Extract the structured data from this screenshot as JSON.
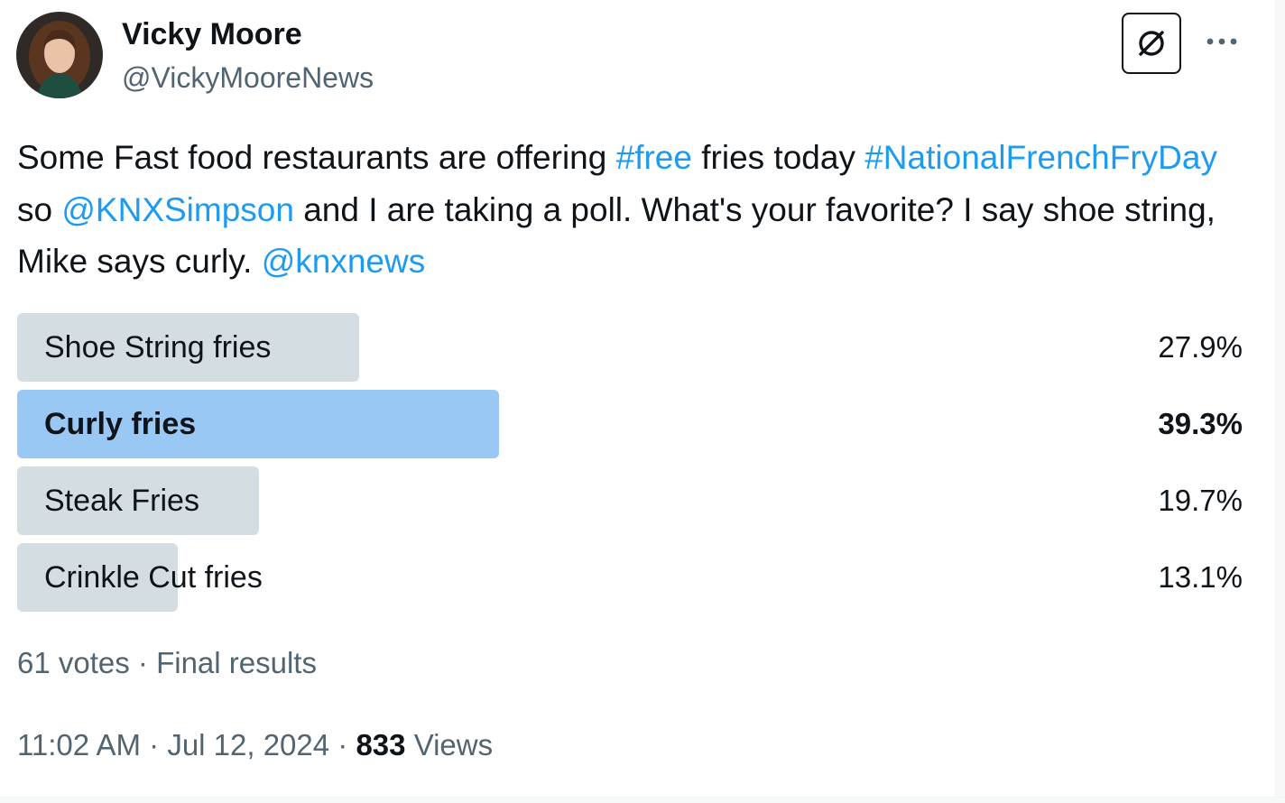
{
  "author": {
    "name": "Vicky Moore",
    "handle": "@VickyMooreNews"
  },
  "tweet": {
    "segments": [
      {
        "text": "Some Fast food restaurants are offering ",
        "type": "text"
      },
      {
        "text": "#free",
        "type": "link"
      },
      {
        "text": " fries today ",
        "type": "text"
      },
      {
        "text": "#NationalFrenchFryDay",
        "type": "link"
      },
      {
        "text": " so ",
        "type": "text"
      },
      {
        "text": "@KNXSimpson",
        "type": "link"
      },
      {
        "text": " and I are taking a poll. What's your favorite? I say shoe string, Mike says curly. ",
        "type": "text"
      },
      {
        "text": "@knxnews",
        "type": "link"
      }
    ]
  },
  "poll": {
    "options": [
      {
        "label": "Shoe String fries",
        "percent_text": "27.9%",
        "percent": 27.9,
        "winner": false
      },
      {
        "label": "Curly fries",
        "percent_text": "39.3%",
        "percent": 39.3,
        "winner": true
      },
      {
        "label": "Steak Fries",
        "percent_text": "19.7%",
        "percent": 19.7,
        "winner": false
      },
      {
        "label": "Crinkle Cut fries",
        "percent_text": "13.1%",
        "percent": 13.1,
        "winner": false
      }
    ],
    "votes": "61 votes",
    "separator": " · ",
    "status": "Final results"
  },
  "meta": {
    "time": "11:02 AM",
    "date": "Jul 12, 2024",
    "views_count": "833",
    "views_label": "Views",
    "separator": " · "
  },
  "icons": {
    "grok": "grok-icon",
    "more": "more-icon"
  },
  "colors": {
    "link": "#1d9bf0",
    "winner_bar": "#8ec2f4",
    "bar": "#cfd9de",
    "secondary_text": "#536471"
  }
}
